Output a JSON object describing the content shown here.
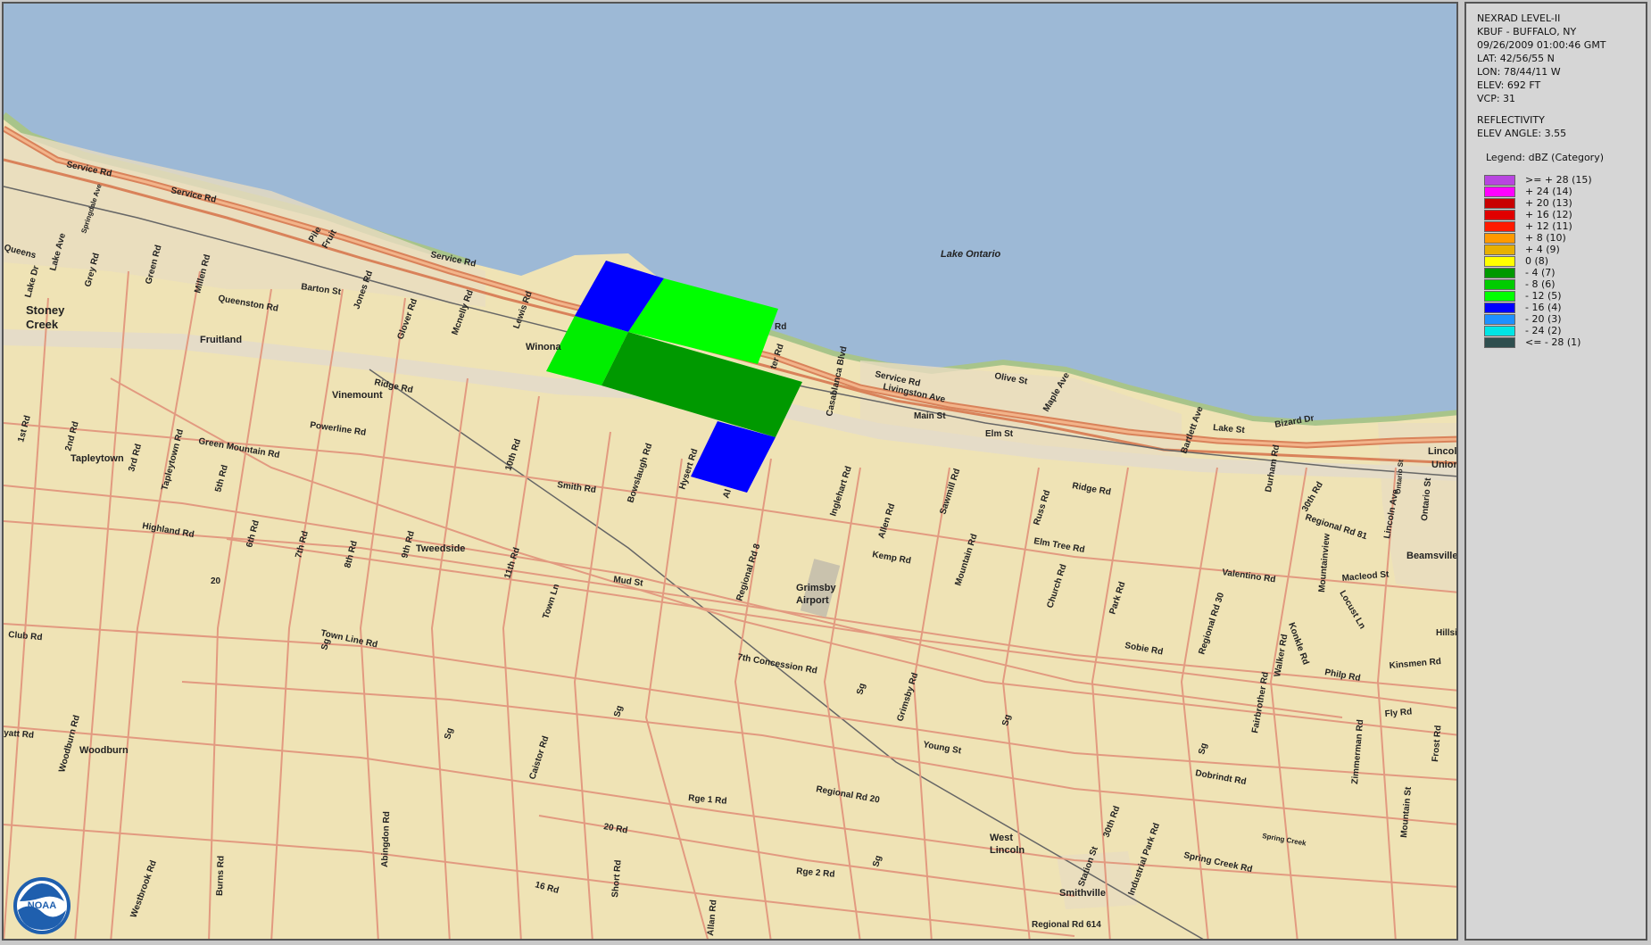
{
  "info": {
    "lines1": [
      "NEXRAD LEVEL-II",
      "KBUF - BUFFALO, NY",
      "09/26/2009 01:00:46 GMT",
      "LAT: 42/56/55 N",
      "LON: 78/44/11 W",
      "ELEV: 692 FT",
      "VCP: 31"
    ],
    "lines2": [
      "REFLECTIVITY",
      "ELEV ANGLE: 3.55"
    ]
  },
  "legend": {
    "title": "Legend: dBZ (Category)",
    "items": [
      {
        "label": ">= + 28 (15)",
        "color": "#b845e0"
      },
      {
        "label": "+ 24 (14)",
        "color": "#ff00ff"
      },
      {
        "label": "+ 20 (13)",
        "color": "#c80000"
      },
      {
        "label": "+ 16 (12)",
        "color": "#e00000"
      },
      {
        "label": "+ 12 (11)",
        "color": "#ff1a00"
      },
      {
        "label": "+ 8 (10)",
        "color": "#ff9900"
      },
      {
        "label": "+ 4 (9)",
        "color": "#e8b000"
      },
      {
        "label": "0 (8)",
        "color": "#ffff00"
      },
      {
        "label": "- 4 (7)",
        "color": "#009900"
      },
      {
        "label": "- 8 (6)",
        "color": "#00cc00"
      },
      {
        "label": "- 12 (5)",
        "color": "#00ff00"
      },
      {
        "label": "- 16 (4)",
        "color": "#0000ff"
      },
      {
        "label": "- 20 (3)",
        "color": "#1e90ff"
      },
      {
        "label": "- 24 (2)",
        "color": "#00e5e5"
      },
      {
        "label": "<= - 28 (1)",
        "color": "#2f4f4f"
      }
    ]
  },
  "map": {
    "water_label": "Lake Ontario",
    "towns": [
      "Stoney",
      "Creek",
      "Fruitland",
      "Winona",
      "Vinemount",
      "Tapleytown",
      "Tweedside",
      "Grimsby",
      "Airport",
      "Woodburn",
      "West",
      "Lincoln",
      "Smithville",
      "Beamsville",
      "Lincoln",
      "Union"
    ],
    "roads": [
      "Service Rd",
      "Service Rd",
      "Service Rd",
      "Service Rd",
      "Barton St",
      "Queenston Rd",
      "Pile",
      "Fruit",
      "Jones Rd",
      "Glover Rd",
      "Mcnelly Rd",
      "Lewis Rd",
      "Ridge Rd",
      "Powerline Rd",
      "Green Mountain Rd",
      "Highland Rd",
      "Smith Rd",
      "Bowslaugh Rd",
      "Hysert Rd",
      "10th Rd",
      "11th Rd",
      "Mud St",
      "Town Ln",
      "Town Line Rd",
      "Club Rd",
      "Regional Rd 8",
      "Inglehart Rd",
      "Allen Rd",
      "Sawmill Rd",
      "Kemp Rd",
      "Mountain Rd",
      "Elm Tree Rd",
      "Church Rd",
      "Park Rd",
      "Russ Rd",
      "Ridge Rd",
      "Regional Rd 30",
      "Valentino Rd",
      "Durham Rd",
      "30th Rd",
      "Regional Rd 81",
      "Macleod St",
      "Lincoln Ave",
      "Ontario St",
      "Sobie Rd",
      "7th Concession Rd",
      "Grimsby Rd",
      "Young St",
      "Regional Rd 20",
      "Rge 1 Rd",
      "Rge 2 Rd",
      "20 Rd",
      "16 Rd",
      "Short Rd",
      "Allan Rd",
      "Abingdon Rd",
      "Burns Rd",
      "Westbrook Rd",
      "Woodburn Rd",
      "Caistor Rd",
      "Kinsmen Rd",
      "Philp Rd",
      "Fly Rd",
      "Frost Rd",
      "Zimmerman Rd",
      "Mountain St",
      "Spring Creek Rd",
      "Industrial Park Rd",
      "Station St",
      "30th Rd",
      "Regional Rd 614",
      "Dobrindt Rd",
      "Fairbrother Rd",
      "Walker Rd",
      "Konkle Rd",
      "Locust Ln",
      "Mountainview",
      "Hillside",
      "Olive St",
      "Livingston Ave",
      "Main St",
      "Elm St",
      "Maple Ave",
      "Casablanca Blvd",
      "Lake St",
      "Bartlett Ave",
      "Bizard Dr",
      "1st Rd",
      "2nd Rd",
      "3rd Rd",
      "5th Rd",
      "6th Rd",
      "7th Rd",
      "8th Rd",
      "9th Rd",
      "Tapleytown Rd",
      "Millen Rd",
      "Green Rd",
      "Grey Rd",
      "Lake Dr",
      "Lake Ave",
      "Queens",
      "Sg",
      "Sg",
      "Sg",
      "Sg",
      "Sg",
      "Sg",
      "Sg",
      "20",
      "yatt Rd",
      "Rd",
      "ter Rd",
      "Al",
      "Springdale Ave",
      "Ontario St",
      "Spring Creek"
    ],
    "logo_text": "NOAA"
  }
}
